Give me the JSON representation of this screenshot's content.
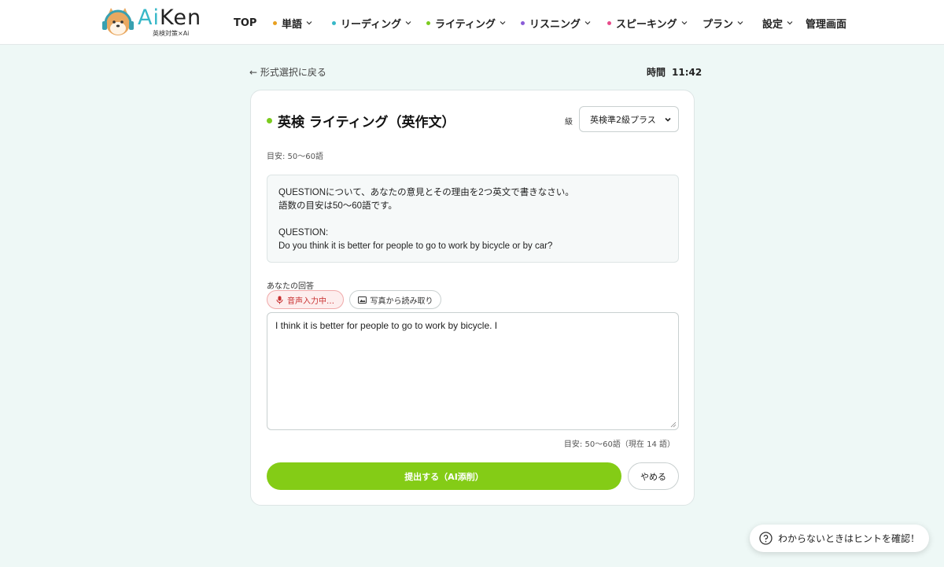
{
  "header": {
    "logo_ai": "Ai",
    "logo_ken": "Ken",
    "logo_sub": "英検対策×Ai",
    "nav": [
      {
        "label": "TOP",
        "dot": "",
        "chevron": false
      },
      {
        "label": "単語",
        "dot": "#e8a020",
        "chevron": true
      },
      {
        "label": "リーディング",
        "dot": "#38b8c8",
        "chevron": true
      },
      {
        "label": "ライティング",
        "dot": "#7bcb1e",
        "chevron": true
      },
      {
        "label": "リスニング",
        "dot": "#8a5cd8",
        "chevron": true
      },
      {
        "label": "スピーキング",
        "dot": "#e84a8a",
        "chevron": true
      },
      {
        "label": "プラン",
        "dot": "",
        "chevron": true
      },
      {
        "label": "設定",
        "dot": "",
        "chevron": true
      },
      {
        "label": "管理画面",
        "dot": "",
        "chevron": false
      }
    ]
  },
  "back_link": "← 形式選択に戻る",
  "timer": {
    "label": "時間",
    "value": "11:42"
  },
  "card": {
    "title": "英検 ライティング（英作文）",
    "grade_label": "級",
    "grade_selected": "英検準2級プラス",
    "target_hint": "目安: 50〜60語",
    "question": {
      "line1": "QUESTIONについて、あなたの意見とその理由を2つ英文で書きなさい。",
      "line2": "語数の目安は50〜60語です。",
      "line3": "QUESTION:",
      "line4": "Do you think it is better for people to go to work by bicycle or by car?"
    },
    "answer_label": "あなたの回答",
    "voice_button": "音声入力中…",
    "photo_button": "写真から読み取り",
    "answer_text": "I think it is better for people to go to work by bicycle. I",
    "word_count": "目安: 50〜60語（現在 14 語）",
    "submit_button": "提出する（AI添削）",
    "quit_button": "やめる"
  },
  "hint_button": "わからないときはヒントを確認！",
  "colors": {
    "accent": "#84cc16",
    "voice": "#c83030",
    "background": "#eef8f6"
  }
}
